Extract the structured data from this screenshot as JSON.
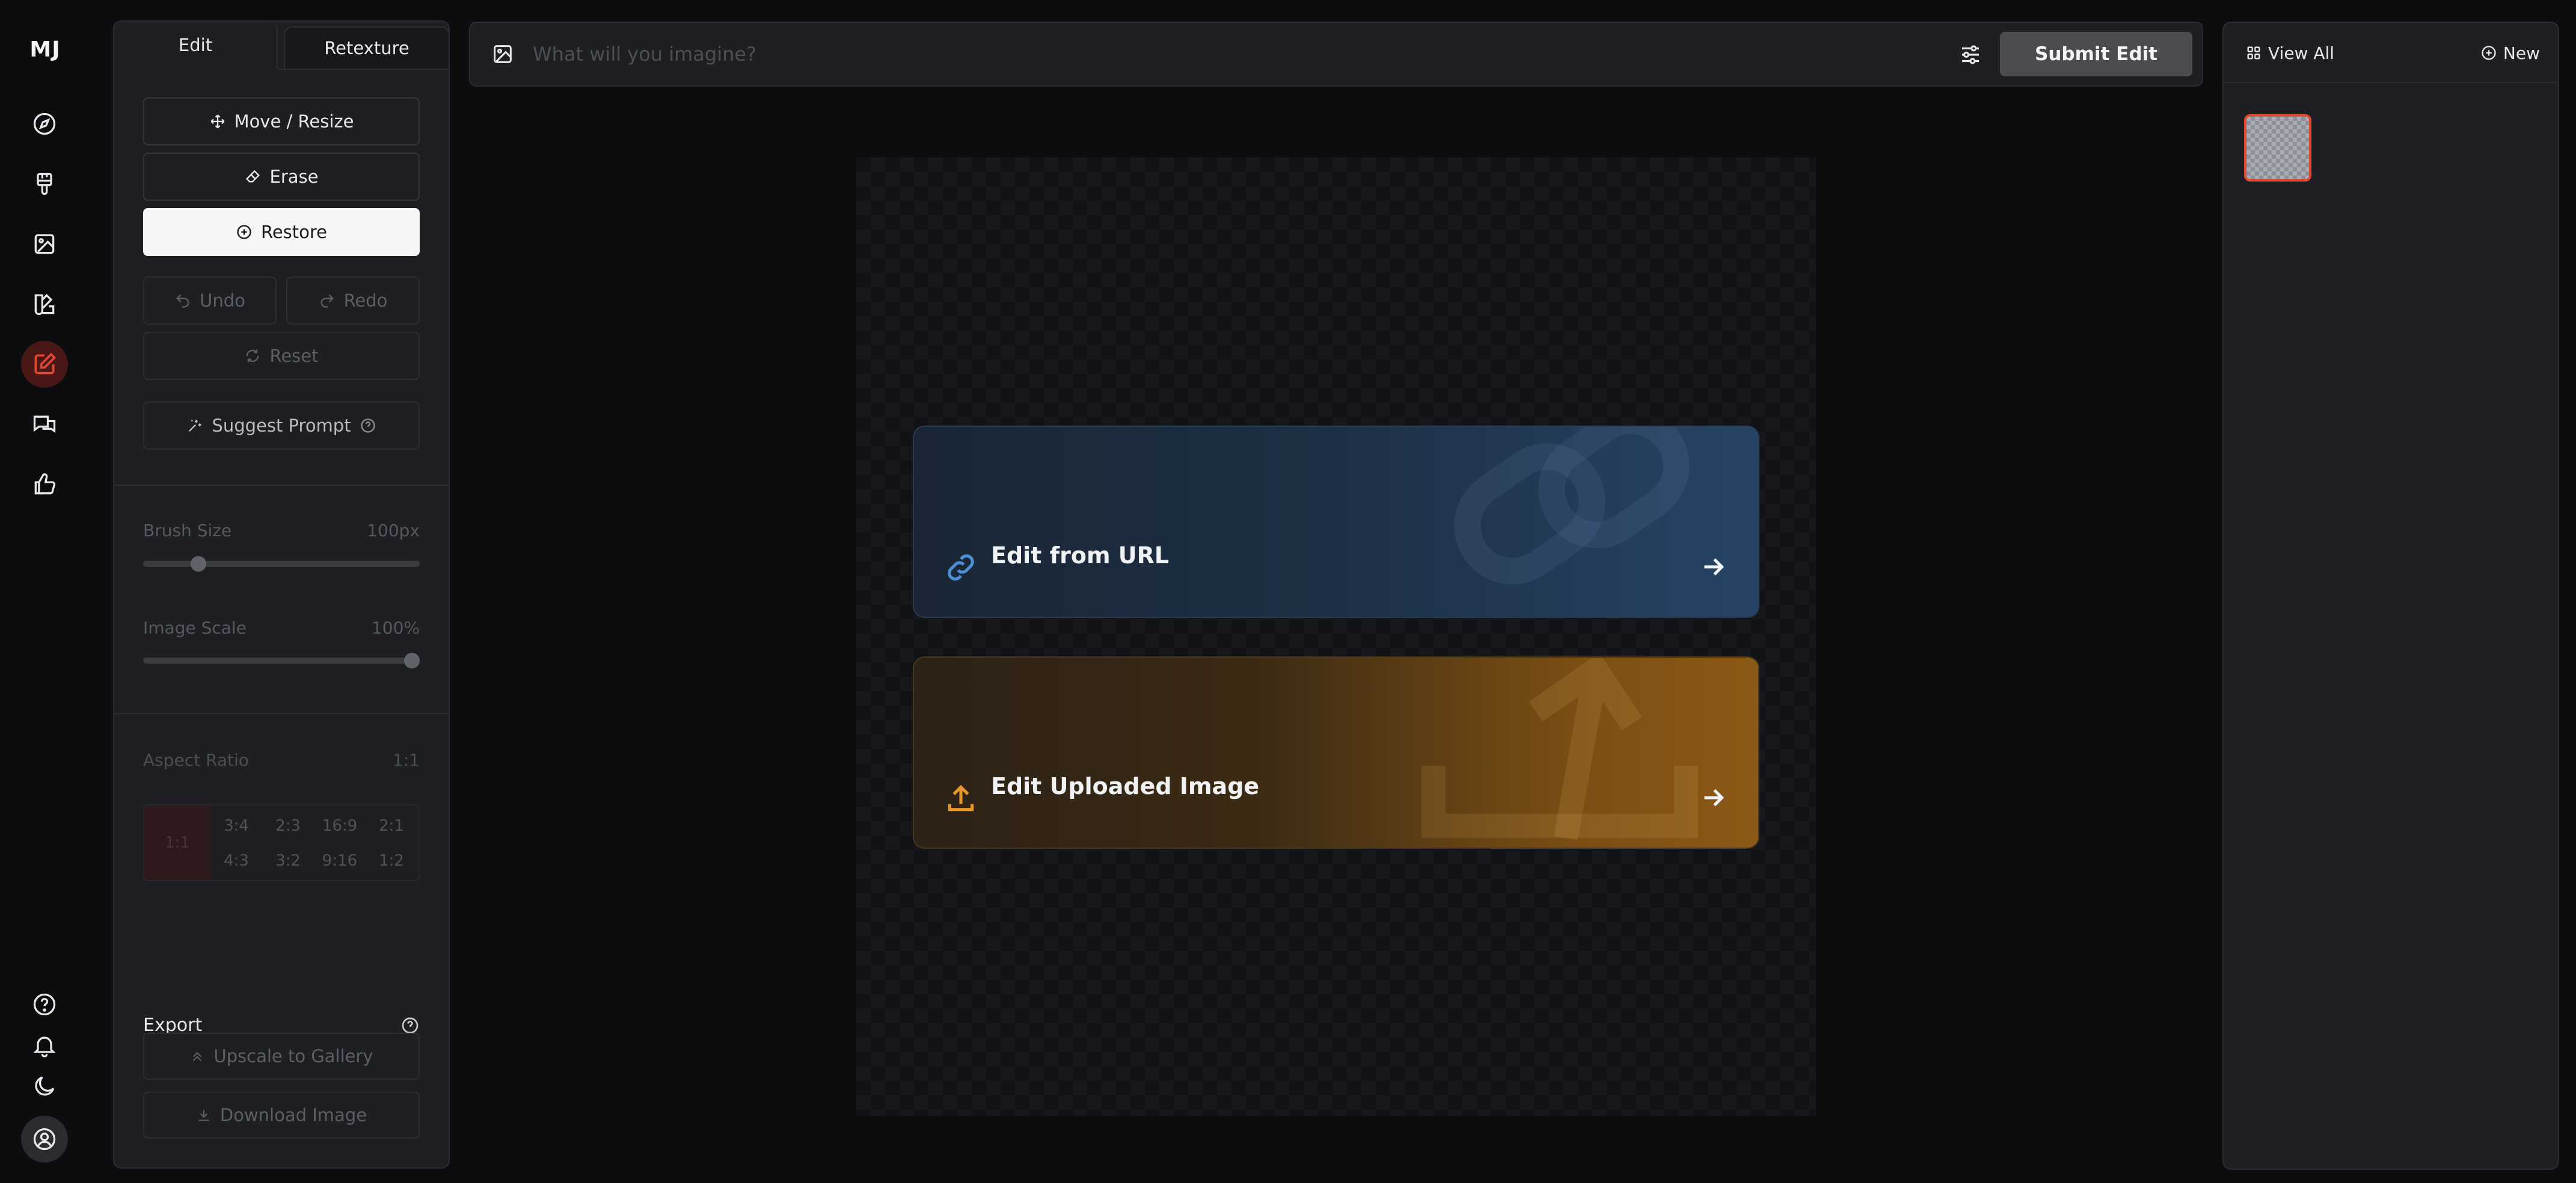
{
  "app": {
    "logo": "MJ"
  },
  "rail": {
    "top_icons": [
      "compass-icon",
      "brush-icon",
      "image-icon",
      "palette-icon",
      "edit-icon",
      "chat-icon",
      "thumbs-up-icon"
    ],
    "active_icon": "edit-icon",
    "bottom_icons": [
      "help-icon",
      "bell-icon",
      "moon-icon",
      "user-icon"
    ],
    "accent": "#e0482f"
  },
  "left_panel": {
    "tabs": [
      {
        "label": "Edit",
        "active": true
      },
      {
        "label": "Retexture",
        "active": false
      }
    ],
    "tools": {
      "move_resize": "Move / Resize",
      "erase": "Erase",
      "restore": "Restore",
      "undo": "Undo",
      "redo": "Redo",
      "reset": "Reset",
      "suggest_prompt": "Suggest Prompt"
    },
    "brush_size": {
      "label": "Brush Size",
      "value": "100px",
      "level": 0.2
    },
    "image_scale": {
      "label": "Image Scale",
      "value": "100%",
      "level": 1.0
    },
    "aspect_ratio": {
      "label": "Aspect Ratio",
      "value": "1:1",
      "options": [
        "1:1",
        "3:4",
        "2:3",
        "16:9",
        "2:1",
        "4:3",
        "3:2",
        "9:16",
        "1:2"
      ]
    },
    "export": {
      "label": "Export",
      "upscale": "Upscale to Gallery",
      "download": "Download Image"
    }
  },
  "top_bar": {
    "placeholder": "What will you imagine?",
    "submit_label": "Submit Edit"
  },
  "canvas": {
    "cards": [
      {
        "label": "Edit from URL",
        "icon": "link-icon",
        "color": "#2b4a6e"
      },
      {
        "label": "Edit Uploaded Image",
        "icon": "upload-icon",
        "color": "#e0902a"
      }
    ]
  },
  "right_panel": {
    "view_all": "View All",
    "new": "New"
  }
}
